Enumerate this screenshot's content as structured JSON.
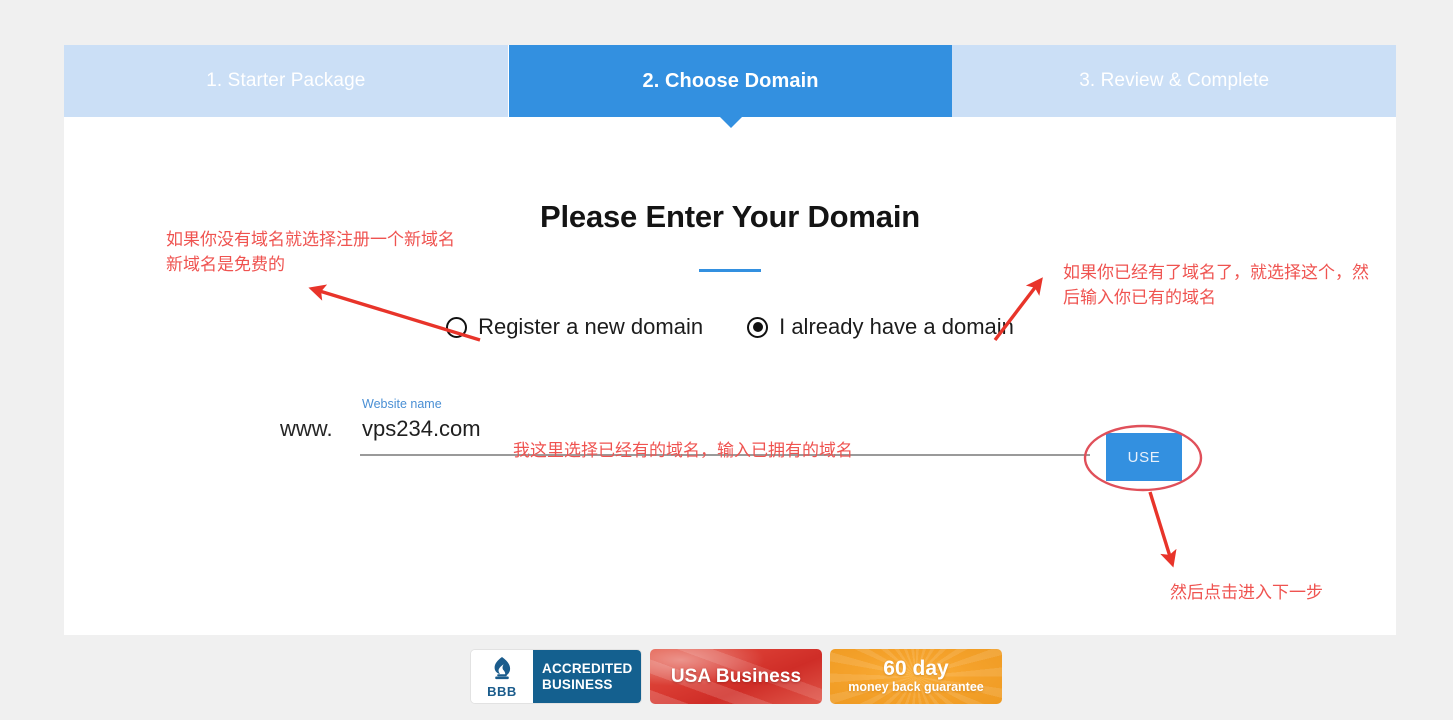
{
  "colors": {
    "page_background": "#f0f0f0",
    "accent_blue": "#3390e0",
    "step_inactive_blue": "#cbdff6",
    "annotation_red": "#ef5350",
    "input_underline": "#9a9a9a",
    "badge_bbb_blue": "#14608f",
    "badge_usa_red": "#d93b32",
    "badge_guarantee_orange": "#f5a22b"
  },
  "steps": [
    {
      "label": "1. Starter Package",
      "active": false
    },
    {
      "label": "2. Choose Domain",
      "active": true
    },
    {
      "label": "3. Review & Complete",
      "active": false
    }
  ],
  "main": {
    "title": "Please Enter Your Domain",
    "options": [
      {
        "label": "Register a new domain",
        "selected": false
      },
      {
        "label": "I already have a domain",
        "selected": true
      }
    ],
    "domain_field": {
      "prefix": "www.",
      "label": "Website name",
      "value": "vps234.com",
      "placeholder": "Website name"
    },
    "use_button": "USE"
  },
  "badges": {
    "bbb": {
      "mark": "BBB",
      "line1": "ACCREDITED",
      "line2": "BUSINESS"
    },
    "usa": "USA Business",
    "guarantee": {
      "main": "60 day",
      "sub": "money back guarantee"
    }
  },
  "annotations": {
    "left": "如果你没有域名就选择注册一个新域名\n新域名是免费的",
    "right": "如果你已经有了域名了，就选择这个，然\n后输入你已有的域名",
    "middle": "我这里选择已经有的域名，输入已拥有的域名",
    "bottom": "然后点击进入下一步"
  }
}
